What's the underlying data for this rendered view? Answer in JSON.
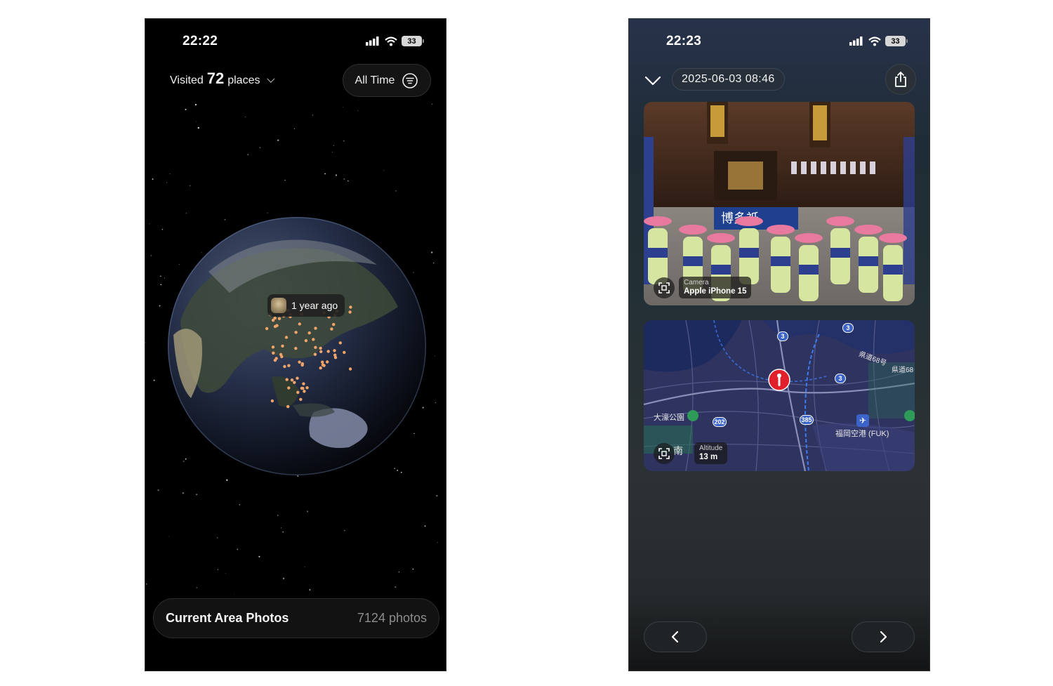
{
  "left_screen": {
    "status": {
      "time": "22:22",
      "battery": "33"
    },
    "header": {
      "visited_prefix": "Visited",
      "visited_count": "72",
      "visited_suffix": "places",
      "filter_label": "All Time"
    },
    "globe": {
      "tooltip_text": "1 year ago",
      "marker_color": "#f0a46a"
    },
    "footer": {
      "title": "Current Area Photos",
      "count": "7124 photos"
    }
  },
  "right_screen": {
    "status": {
      "time": "22:23",
      "battery": "33"
    },
    "header": {
      "date": "2025-06-03 08:46"
    },
    "photo": {
      "camera_label": "Camera",
      "camera_value": "Apple iPhone 15",
      "banner_text": "博多祇"
    },
    "map": {
      "altitude_label": "Altitude",
      "altitude_value": "13 m",
      "labels": {
        "park": "大濠公園",
        "airport": "福岡空港 (FUK)",
        "road_1": "県道68号",
        "road_2": "県道68",
        "partial": "南",
        "r202": "202",
        "r385": "385",
        "r3a": "3",
        "r3b": "3",
        "r3c": "3"
      },
      "pin_color": "#e0202a"
    }
  }
}
